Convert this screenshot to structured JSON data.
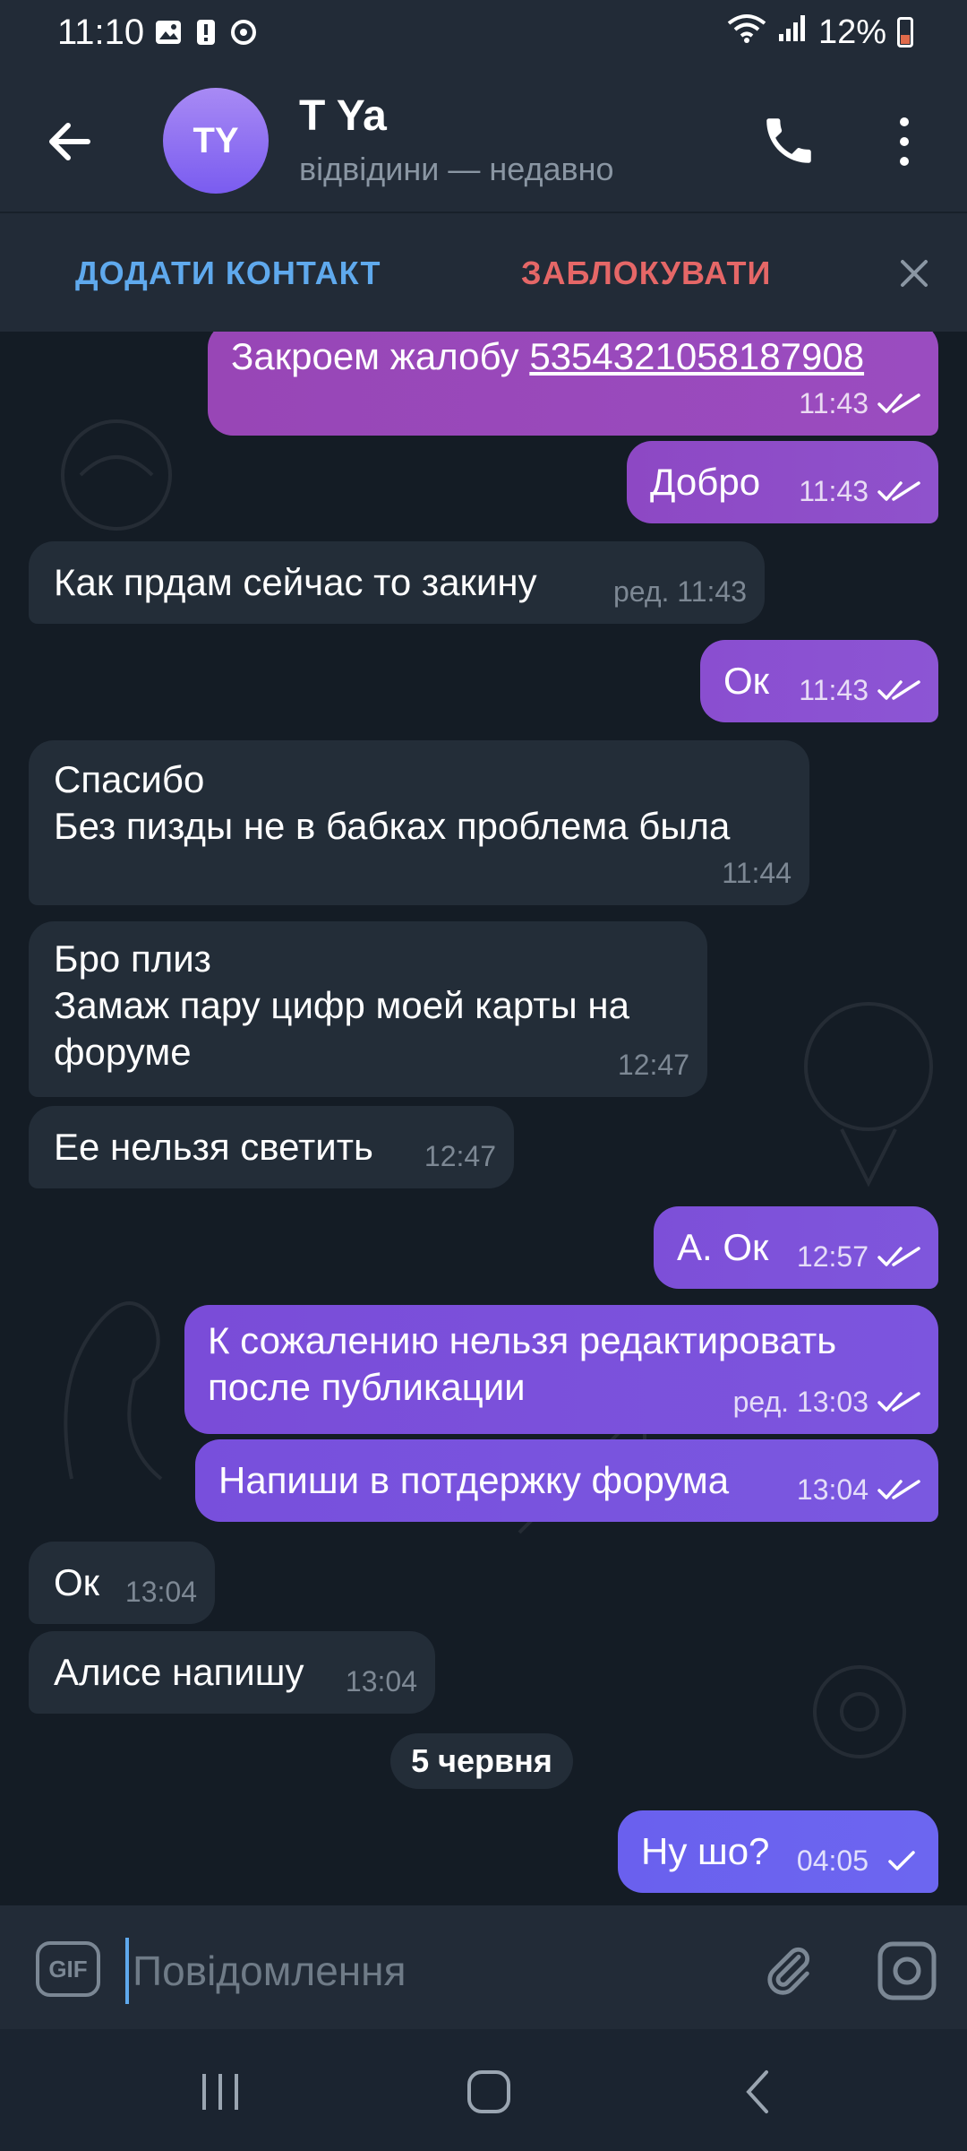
{
  "status_bar": {
    "time": "11:10",
    "battery": "12%",
    "battery_level": 0.12
  },
  "header": {
    "avatar_initials": "TY",
    "contact_name": "T Ya",
    "contact_status": "відвідини — недавно"
  },
  "action_bar": {
    "add_contact": "ДОДАТИ КОНТАКТ",
    "block": "ЗАБЛОКУВАТИ"
  },
  "messages": [
    {
      "text": "Закроем жалобу 5354321058187908",
      "time": "11:43",
      "dir": "out",
      "ticks": "double",
      "link": "5354321058187908"
    },
    {
      "text": "Добро",
      "time": "11:43",
      "dir": "out",
      "ticks": "double"
    },
    {
      "text": "Как прдам сейчас то закину",
      "time": "ред. 11:43",
      "dir": "in"
    },
    {
      "text": "Ок",
      "time": "11:43",
      "dir": "out",
      "ticks": "double"
    },
    {
      "text": "Спасибо\nБез пизды не в бабках проблема была",
      "time": "11:44",
      "dir": "in"
    },
    {
      "text": "Бро плиз\nЗамаж пару цифр моей карты на\nфоруме",
      "time": "12:47",
      "dir": "in"
    },
    {
      "text": "Ее нельзя светить",
      "time": "12:47",
      "dir": "in"
    },
    {
      "text": "А. Ок",
      "time": "12:57",
      "dir": "out",
      "ticks": "double"
    },
    {
      "text": "К сожалению нельзя редактировать\nпосле публикации",
      "time": "ред. 13:03",
      "dir": "out",
      "ticks": "double"
    },
    {
      "text": "Напиши в потдержку форума",
      "time": "13:04",
      "dir": "out",
      "ticks": "double"
    },
    {
      "text": "Ок",
      "time": "13:04",
      "dir": "in"
    },
    {
      "text": "Алисе напишу",
      "time": "13:04",
      "dir": "in"
    },
    {
      "text": "Ну шо?",
      "time": "04:05",
      "dir": "out",
      "ticks": "single"
    }
  ],
  "date_separator": "5 червня",
  "composer": {
    "gif_label": "GIF",
    "placeholder": "Повідомлення"
  },
  "colors": {
    "outgoing_bubble_top": "#9b4dbd",
    "outgoing_bubble_bottom": "#6a62ee",
    "incoming_bubble": "#232d38",
    "accent_blue": "#5fa9ed",
    "accent_red": "#e56767"
  }
}
